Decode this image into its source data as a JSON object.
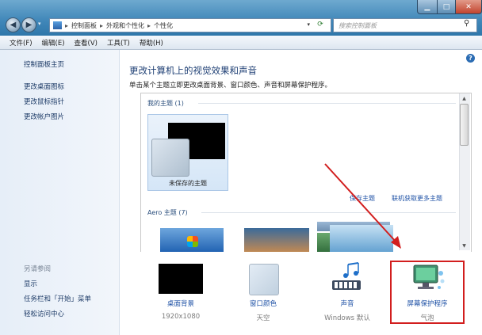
{
  "window": {
    "min_glyph": "▁",
    "max_glyph": "□",
    "close_glyph": "✕"
  },
  "address": {
    "segments": [
      "控制面板",
      "外观和个性化",
      "个性化"
    ],
    "separator": "▸",
    "search_placeholder": "搜索控制面板"
  },
  "menu": [
    "文件(F)",
    "编辑(E)",
    "查看(V)",
    "工具(T)",
    "帮助(H)"
  ],
  "sidebar": {
    "links": [
      "控制面板主页",
      "更改桌面图标",
      "更改鼠标指针",
      "更改帐户图片"
    ],
    "see_also_title": "另请参阅",
    "see_also": [
      "显示",
      "任务栏和「开始」菜单",
      "轻松访问中心"
    ]
  },
  "main": {
    "title": "更改计算机上的视觉效果和声音",
    "subtitle": "单击某个主题立即更改桌面背景、窗口颜色、声音和屏幕保护程序。",
    "my_themes_label": "我的主题 (1)",
    "unsaved_theme": "未保存的主题",
    "save_theme": "保存主题",
    "get_more_themes": "联机获取更多主题",
    "aero_label": "Aero 主题 (7)"
  },
  "bottom": {
    "desktop_background": {
      "label": "桌面背景",
      "value": "1920x1080"
    },
    "window_color": {
      "label": "窗口颜色",
      "value": "天空"
    },
    "sounds": {
      "label": "声音",
      "value": "Windows 默认"
    },
    "screen_saver": {
      "label": "屏幕保护程序",
      "value": "气泡"
    }
  },
  "colors": {
    "highlight": "#d21e1e",
    "link": "#1f52a6",
    "title": "#1e3f74"
  }
}
